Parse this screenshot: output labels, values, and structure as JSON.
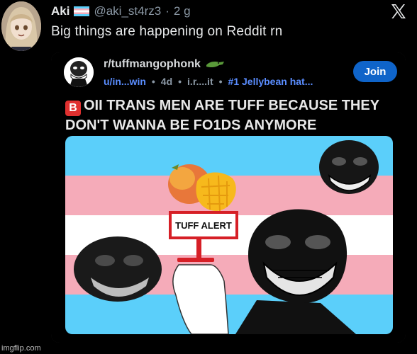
{
  "user": {
    "name": "Aki",
    "handle": "@aki_st4rz3",
    "separator": "·",
    "time": "2 g"
  },
  "tweet": {
    "text": "Big things are happening on Reddit rn"
  },
  "icons": {
    "flag": "trans-flag-icon",
    "x": "x-logo-icon",
    "croc": "crocodile-icon"
  },
  "reddit": {
    "subreddit": "r/tuffmangophonk",
    "author": "u/in...win",
    "age": "4d",
    "via": "i.r....it",
    "award": "#1 Jellybean hat...",
    "dot": "•",
    "join_label": "Join",
    "headline_emoji": "B",
    "headline": "OII TRANS MEN ARE TUFF BECAUSE THEY DON'T WANNA BE FO1DS ANYMORE",
    "sign_text": "TUFF ALERT"
  },
  "colors": {
    "flag_blue": "#5bcffa",
    "flag_pink": "#f5abb9",
    "flag_white": "#ffffff",
    "join_blue": "#0f64c9",
    "sign_red": "#d61f26"
  },
  "watermark": "imgflip.com"
}
